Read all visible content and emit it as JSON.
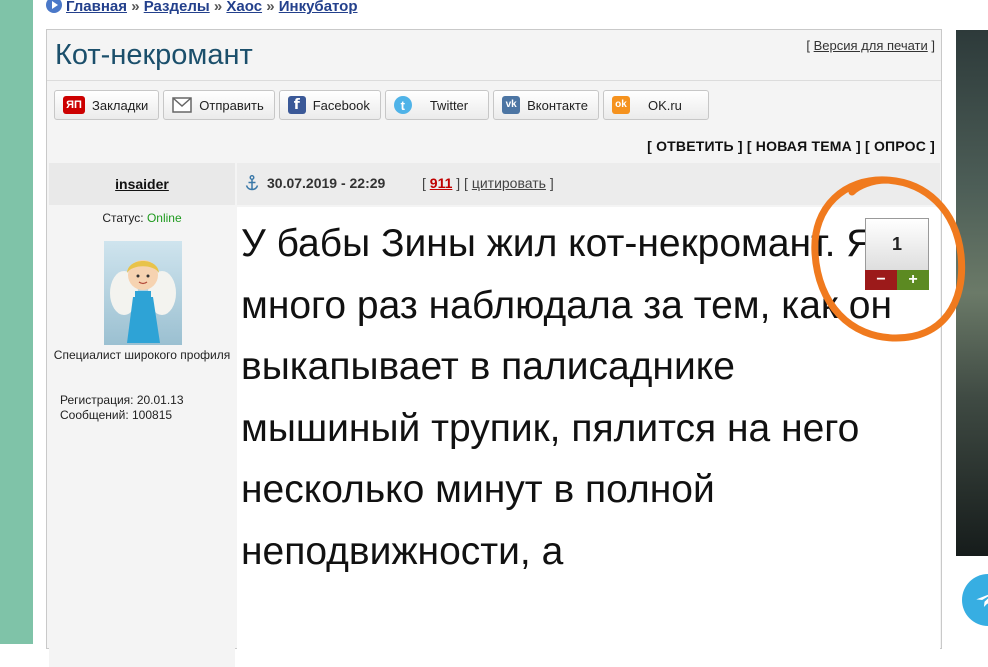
{
  "breadcrumb": {
    "items": [
      "Главная",
      "Разделы",
      "Хаос",
      "Инкубатор"
    ],
    "separator": "»"
  },
  "topic": {
    "title": "Кот-некромант",
    "print_link": "Версия для печати"
  },
  "share_bar": {
    "buttons": [
      {
        "label": "Закладки",
        "icon_text": "ЯП",
        "icon": "yandex-bookmarks-icon"
      },
      {
        "label": "Отправить",
        "icon": "mail-envelope-icon"
      },
      {
        "label": "Facebook",
        "icon_text": "f",
        "icon": "facebook-icon"
      },
      {
        "label": "Twitter",
        "icon_text": "t",
        "icon": "twitter-icon"
      },
      {
        "label": "Вконтакте",
        "icon_text": "vk",
        "icon": "vk-icon"
      },
      {
        "label": "OK.ru",
        "icon_text": "ok",
        "icon": "odnoklassniki-icon"
      }
    ]
  },
  "post_actions": {
    "reply": "ОТВЕТИТЬ",
    "new_topic": "НОВАЯ ТЕМА",
    "poll": "ОПРОС"
  },
  "post": {
    "author": "insaider",
    "date": "30.07.2019 - 22:29",
    "reply_count": "911",
    "quote_label": "цитировать",
    "status_label": "Статус:",
    "status_value": "Online",
    "rank": "Специалист широкого профиля",
    "registration": "Регистрация: 20.01.13",
    "messages": "Сообщений: 100815",
    "text": "У бабы Зины жил кот-некромант. Я много раз наблюдала за тем, как он выкапывает в палисаднике мышиный трупик, пялится на него несколько минут в полной неподвижности, а",
    "rating": "1",
    "minus_label": "−",
    "plus_label": "+"
  },
  "colors": {
    "left_strip": "#7fc3a8",
    "title": "#1b4f6b",
    "breadcrumb": "#23408c",
    "online": "#1e9a1e",
    "reply_count": "#c00000",
    "vote_minus": "#9c1a1a",
    "vote_plus": "#5c8a22",
    "annotation": "#f07a1e",
    "telegram": "#37aee2"
  }
}
